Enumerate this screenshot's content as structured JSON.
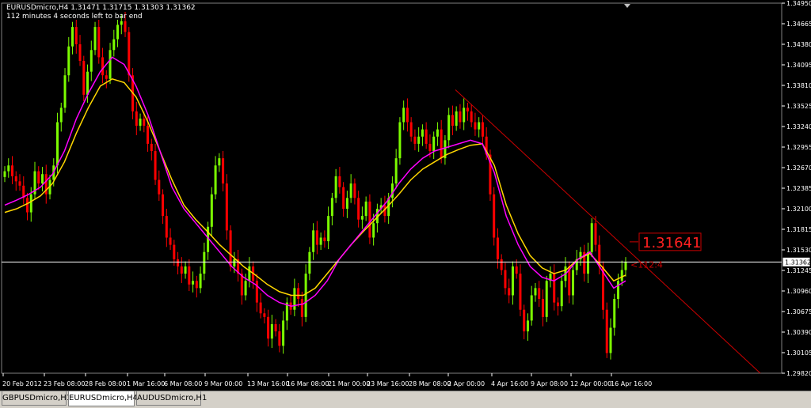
{
  "chart_info": {
    "line1": "EURUSDmicro,H4  1.31471 1.31715 1.31303 1.31362",
    "line2": "112 minutes 4 seconds left to bar end"
  },
  "price_axis": {
    "labels": [
      "1.34950",
      "1.34665",
      "1.34380",
      "1.34095",
      "1.33810",
      "1.33525",
      "1.33240",
      "1.32955",
      "1.32670",
      "1.32385",
      "1.32100",
      "1.31815",
      "1.31530",
      "1.31245",
      "1.30960",
      "1.30675",
      "1.30390",
      "1.30105",
      "1.29820"
    ],
    "current_price": "1.31362"
  },
  "time_axis": {
    "labels": [
      "20 Feb 2012",
      "23 Feb 08:00",
      "28 Feb 08:00",
      "1 Mar 16:00",
      "6 Mar 08:00",
      "9 Mar 00:00",
      "13 Mar 16:00",
      "16 Mar 08:00",
      "21 Mar 00:00",
      "23 Mar 16:00",
      "28 Mar 08:00",
      "2 Apr 00:00",
      "4 Apr 16:00",
      "9 Apr 08:00",
      "12 Apr 00:00",
      "16 Apr 16:00"
    ]
  },
  "annotations": {
    "big_price": "1.31641",
    "bar_timer": "<112:4"
  },
  "tabs": [
    {
      "label": "GBPUSDmicro,H1",
      "active": false
    },
    {
      "label": "EURUSDmicro,H4",
      "active": true
    },
    {
      "label": "AUDUSDmicro,H1",
      "active": false
    }
  ],
  "colors": {
    "background": "#000000",
    "bull_candle": "#7cfc00",
    "bear_candle": "#ff0000",
    "ma_fast": "#ff00ff",
    "ma_slow": "#ffd700",
    "trendline": "#cc0000",
    "grid": "#ffffff"
  },
  "chart_data": {
    "type": "candlestick",
    "symbol": "EURUSDmicro",
    "timeframe": "H4",
    "ylim": [
      1.2982,
      1.3495
    ],
    "close_series": [
      1.3262,
      1.327,
      1.3255,
      1.3248,
      1.3242,
      1.3225,
      1.3205,
      1.323,
      1.3262,
      1.3245,
      1.3258,
      1.323,
      1.325,
      1.327,
      1.333,
      1.335,
      1.3395,
      1.3435,
      1.3462,
      1.3438,
      1.3415,
      1.3368,
      1.34,
      1.343,
      1.3462,
      1.342,
      1.3395,
      1.339,
      1.343,
      1.3445,
      1.3465,
      1.347,
      1.3455,
      1.3395,
      1.3345,
      1.3325,
      1.3335,
      1.3325,
      1.33,
      1.329,
      1.325,
      1.323,
      1.32,
      1.317,
      1.316,
      1.314,
      1.313,
      1.312,
      1.313,
      1.3105,
      1.311,
      1.31,
      1.312,
      1.315,
      1.3185,
      1.323,
      1.327,
      1.328,
      1.3245,
      1.318,
      1.313,
      1.314,
      1.312,
      1.309,
      1.311,
      1.313,
      1.311,
      1.308,
      1.3065,
      1.306,
      1.303,
      1.305,
      1.304,
      1.302,
      1.3055,
      1.308,
      1.307,
      1.31,
      1.3085,
      1.306,
      1.312,
      1.315,
      1.318,
      1.316,
      1.317,
      1.3165,
      1.32,
      1.3225,
      1.3255,
      1.324,
      1.321,
      1.3225,
      1.3245,
      1.3225,
      1.3195,
      1.32,
      1.322,
      1.317,
      1.319,
      1.321,
      1.3215,
      1.32,
      1.3225,
      1.3245,
      1.328,
      1.333,
      1.335,
      1.333,
      1.331,
      1.33,
      1.331,
      1.332,
      1.33,
      1.329,
      1.331,
      1.332,
      1.328,
      1.3305,
      1.334,
      1.3325,
      1.3345,
      1.333,
      1.335,
      1.3345,
      1.333,
      1.332,
      1.333,
      1.331,
      1.3285,
      1.323,
      1.317,
      1.314,
      1.3125,
      1.31,
      1.309,
      1.313,
      1.312,
      1.307,
      1.304,
      1.3055,
      1.309,
      1.31,
      1.3085,
      1.306,
      1.311,
      1.312,
      1.308,
      1.3075,
      1.311,
      1.313,
      1.309,
      1.3125,
      1.314,
      1.315,
      1.312,
      1.315,
      1.319,
      1.316,
      1.313,
      1.307,
      1.301,
      1.3045,
      1.3085,
      1.311,
      1.3125,
      1.3136
    ],
    "ma_fast_series": [
      1.3215,
      1.3222,
      1.323,
      1.324,
      1.3258,
      1.329,
      1.3335,
      1.337,
      1.34,
      1.342,
      1.341,
      1.338,
      1.334,
      1.329,
      1.324,
      1.321,
      1.319,
      1.317,
      1.315,
      1.313,
      1.3115,
      1.3105,
      1.309,
      1.308,
      1.3075,
      1.3078,
      1.309,
      1.311,
      1.314,
      1.316,
      1.318,
      1.32,
      1.322,
      1.3245,
      1.3265,
      1.328,
      1.329,
      1.3295,
      1.33,
      1.3305,
      1.33,
      1.326,
      1.32,
      1.316,
      1.313,
      1.3115,
      1.311,
      1.312,
      1.314,
      1.315,
      1.3125,
      1.31,
      1.311
    ],
    "ma_slow_series": [
      1.3205,
      1.321,
      1.3218,
      1.3228,
      1.3245,
      1.3275,
      1.3315,
      1.335,
      1.338,
      1.339,
      1.3385,
      1.3365,
      1.333,
      1.329,
      1.325,
      1.3215,
      1.3195,
      1.3178,
      1.316,
      1.3145,
      1.313,
      1.3118,
      1.3105,
      1.3095,
      1.309,
      1.309,
      1.31,
      1.312,
      1.314,
      1.316,
      1.3178,
      1.3195,
      1.3212,
      1.323,
      1.325,
      1.3265,
      1.3275,
      1.3285,
      1.3292,
      1.3298,
      1.33,
      1.327,
      1.3215,
      1.3175,
      1.3145,
      1.3128,
      1.312,
      1.3125,
      1.314,
      1.3148,
      1.313,
      1.311,
      1.3118
    ],
    "trendline": {
      "from_price": 1.3375,
      "to_price": 1.2982,
      "from_time": "2 Apr 00:00"
    },
    "current_price": 1.31362,
    "annotated_price": 1.31641
  }
}
